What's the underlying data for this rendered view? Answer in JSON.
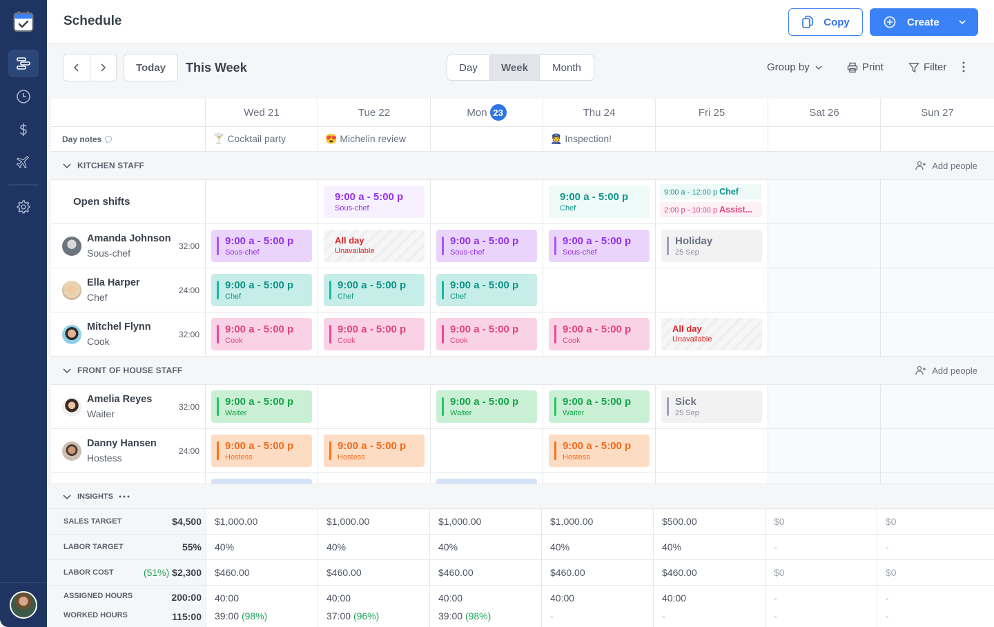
{
  "app": {
    "title": "Schedule",
    "copy_label": "Copy",
    "create_label": "Create"
  },
  "sidebar": {
    "items": [
      {
        "icon": "schedule-icon",
        "active": true
      },
      {
        "icon": "clock-icon"
      },
      {
        "icon": "dollar-icon"
      },
      {
        "icon": "airplane-icon"
      },
      {
        "icon": "gear-icon"
      }
    ]
  },
  "toolbar": {
    "today_label": "Today",
    "range_label": "This Week",
    "views": [
      "Day",
      "Week",
      "Month"
    ],
    "active_view": "Week",
    "group_by_label": "Group by",
    "print_label": "Print",
    "filter_label": "Filter"
  },
  "days": [
    {
      "label": "Wed 21"
    },
    {
      "label": "Tue 22"
    },
    {
      "label": "Mon",
      "badge": "23"
    },
    {
      "label": "Thu 24"
    },
    {
      "label": "Fri 25"
    },
    {
      "label": "Sat 26"
    },
    {
      "label": "Sun 27"
    }
  ],
  "day_notes": {
    "label": "Day notes",
    "notes": [
      "🍸 Cocktail party",
      "😍 Michelin review",
      "",
      "👮 Inspection!",
      "",
      "",
      ""
    ]
  },
  "groups": {
    "kitchen": {
      "title": "KITCHEN STAFF",
      "add_label": "Add people"
    },
    "foh": {
      "title": "FRONT OF HOUSE STAFF",
      "add_label": "Add people"
    }
  },
  "open_shifts": {
    "label": "Open shifts",
    "tue": {
      "time": "9:00 a - 5:00 p",
      "role": "Sous-chef"
    },
    "thu": {
      "time": "9:00 a - 5:00 p",
      "role": "Chef"
    },
    "fri": [
      {
        "time": "9:00 a - 12:00 p",
        "role": "Chef"
      },
      {
        "time": "2:00 p - 10:00 p",
        "role": "Assist..."
      }
    ]
  },
  "employees": [
    {
      "name": "Amanda Johnson",
      "role": "Sous-chef",
      "hours": "32:00",
      "shifts": [
        {
          "time": "9:00 a - 5:00 p",
          "role": "Sous-chef"
        },
        {
          "time": "All day",
          "role": "Unavailable"
        },
        {
          "time": "9:00 a - 5:00 p",
          "role": "Sous-chef"
        },
        {
          "time": "9:00 a - 5:00 p",
          "role": "Sous-chef"
        },
        {
          "time": "Holiday",
          "role": "25 Sep"
        }
      ]
    },
    {
      "name": "Ella Harper",
      "role": "Chef",
      "hours": "24:00",
      "shifts": [
        {
          "time": "9:00 a - 5:00 p",
          "role": "Chef"
        },
        {
          "time": "9:00 a - 5:00 p",
          "role": "Chef"
        },
        {
          "time": "9:00 a - 5:00 p",
          "role": "Chef"
        }
      ]
    },
    {
      "name": "Mitchel Flynn",
      "role": "Cook",
      "hours": "32:00",
      "shifts": [
        {
          "time": "9:00 a - 5:00 p",
          "role": "Cook"
        },
        {
          "time": "9:00 a - 5:00 p",
          "role": "Cook"
        },
        {
          "time": "9:00 a - 5:00 p",
          "role": "Cook"
        },
        {
          "time": "9:00 a - 5:00 p",
          "role": "Cook"
        },
        {
          "time": "All day",
          "role": "Unavailable"
        }
      ]
    },
    {
      "name": "Amelia Reyes",
      "role": "Waiter",
      "hours": "32:00",
      "shifts": [
        {
          "time": "9:00 a - 5:00 p",
          "role": "Waiter"
        },
        {
          "time": "9:00 a - 5:00 p",
          "role": "Waiter"
        },
        {
          "time": "9:00 a - 5:00 p",
          "role": "Waiter"
        },
        {
          "time": "Sick",
          "role": "25 Sep"
        }
      ]
    },
    {
      "name": "Danny Hansen",
      "role": "Hostess",
      "hours": "24:00",
      "shifts": [
        {
          "time": "9:00 a - 5:00 p",
          "role": "Hostess"
        },
        {
          "time": "9:00 a - 5:00 p",
          "role": "Hostess"
        },
        {
          "time": "9:00 a - 5:00 p",
          "role": "Hostess"
        }
      ]
    }
  ],
  "insights": {
    "title": "INSIGHTS",
    "sales_target": {
      "label": "SALES TARGET",
      "total": "$4,500",
      "values": [
        "$1,000.00",
        "$1,000.00",
        "$1,000.00",
        "$1,000.00",
        "$500.00",
        "$0",
        "$0"
      ]
    },
    "labor_target": {
      "label": "LABOR TARGET",
      "total": "55%",
      "values": [
        "40%",
        "40%",
        "40%",
        "40%",
        "40%",
        "-",
        "-"
      ]
    },
    "labor_cost": {
      "label": "LABOR COST",
      "pct": "(51%)",
      "total": "$2,300",
      "values": [
        "$460.00",
        "$460.00",
        "$460.00",
        "$460.00",
        "$460.00",
        "$0",
        "$0"
      ]
    },
    "assigned_hours": {
      "label": "ASSIGNED HOURS",
      "total": "200:00",
      "values": [
        "40:00",
        "40:00",
        "40:00",
        "40:00",
        "40:00",
        "-",
        "-"
      ]
    },
    "worked_hours": {
      "label": "WORKED HOURS",
      "total": "115:00",
      "values": [
        "39:00",
        "37:00",
        "39:00",
        "-",
        "-",
        "-",
        "-"
      ],
      "pcts": [
        "(98%)",
        "(96%)",
        "(98%)",
        "",
        "",
        "",
        ""
      ]
    }
  },
  "colors": {
    "accent": "#3b82f6",
    "sidebar": "#1f3461",
    "sous_chef": "#a855f7",
    "chef": "#14b8a6",
    "cook": "#ec4899",
    "waiter": "#22c55e",
    "hostess": "#f97316",
    "unavailable": "#dc2626"
  }
}
